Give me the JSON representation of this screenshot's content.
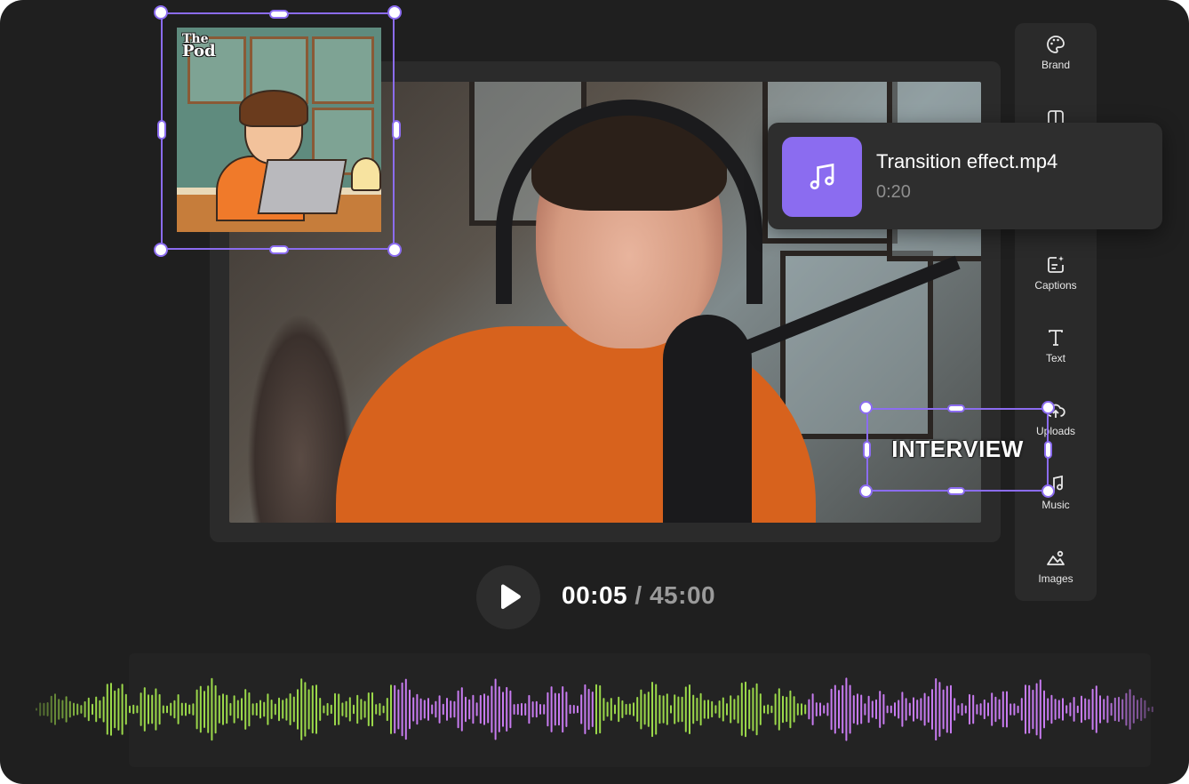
{
  "pod_logo": {
    "line1": "The",
    "line2": "Pod"
  },
  "overlay_text": "INTERVIEW",
  "sidebar": {
    "items": [
      {
        "label": "Brand",
        "icon": "palette-icon"
      },
      {
        "label": "",
        "icon": "layout-icon"
      },
      {
        "label": "",
        "icon": "people-icon"
      },
      {
        "label": "Captions",
        "icon": "captions-icon"
      },
      {
        "label": "Text",
        "icon": "text-icon"
      },
      {
        "label": "Uploads",
        "icon": "upload-cloud-icon"
      },
      {
        "label": "Music",
        "icon": "music-note-icon"
      },
      {
        "label": "Images",
        "icon": "image-icon"
      }
    ]
  },
  "file_card": {
    "name": "Transition effect.mp4",
    "duration": "0:20",
    "icon": "music-note-icon"
  },
  "playback": {
    "current": "00:05",
    "separator": "/",
    "total": "45:00"
  },
  "colors": {
    "accent_purple": "#8b6cf0",
    "wave_green": "#9bd84a",
    "wave_pink": "#c77bf0",
    "background": "#1f1f1f"
  },
  "waveform": {
    "segments": [
      {
        "color": "green",
        "start": 0.0,
        "end": 0.32
      },
      {
        "color": "pink",
        "start": 0.32,
        "end": 0.5
      },
      {
        "color": "green",
        "start": 0.5,
        "end": 0.69
      },
      {
        "color": "pink",
        "start": 0.69,
        "end": 1.0
      }
    ]
  }
}
